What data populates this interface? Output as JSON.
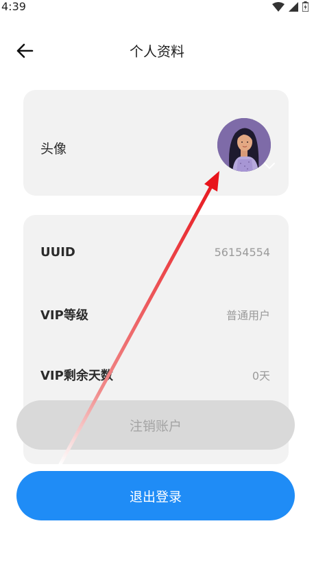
{
  "status_bar": {
    "time": "4:39",
    "icons": [
      "wifi-icon",
      "signal-icon",
      "battery-icon"
    ]
  },
  "header": {
    "back_icon": "arrow-left-icon",
    "title": "个人资料"
  },
  "avatar_section": {
    "label": "头像",
    "avatar_icon": "user-avatar",
    "indicator_icon": "chevron-down-icon"
  },
  "info_section": {
    "rows": [
      {
        "label": "UUID",
        "value": "56154554"
      },
      {
        "label": "VIP等级",
        "value": "普通用户"
      },
      {
        "label": "VIP剩余天数",
        "value": "0天"
      }
    ]
  },
  "buttons": {
    "delete_account": "注销账户",
    "logout": "退出登录"
  },
  "colors": {
    "accent": "#1f8cf6",
    "card_bg": "#f2f2f2",
    "disabled_btn": "#d9d9d9",
    "annotation_arrow": "#e8141b"
  }
}
